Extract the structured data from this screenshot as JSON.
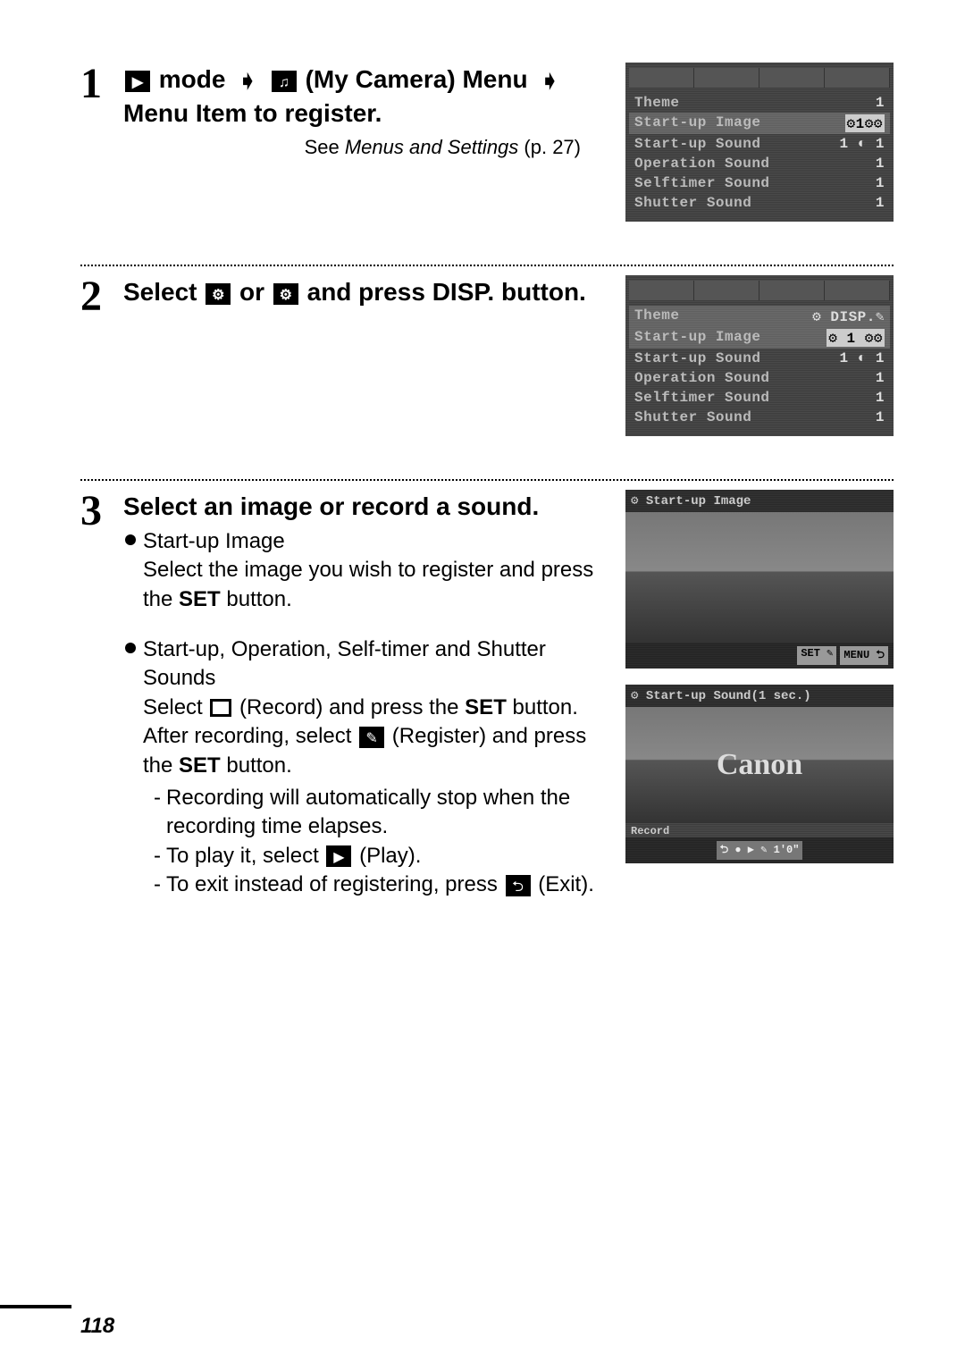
{
  "page_number": "118",
  "step1": {
    "num": "1",
    "title_part1": "mode",
    "title_part2": "(My Camera) Menu",
    "title_part3": "Menu Item to register.",
    "subtitle_prefix": "See ",
    "subtitle_ital": "Menus and Settings",
    "subtitle_suffix": " (p. 27)",
    "lcd": {
      "rows": [
        {
          "label": "Theme",
          "value": "1"
        },
        {
          "label": "Start-up Image",
          "value": "⚙1⚙⚙"
        },
        {
          "label": "Start-up Sound",
          "value": "1 ◐ 1"
        },
        {
          "label": "Operation Sound",
          "value": "1"
        },
        {
          "label": "Selftimer Sound",
          "value": "1"
        },
        {
          "label": "Shutter Sound",
          "value": "1"
        }
      ]
    }
  },
  "step2": {
    "num": "2",
    "title_a": "Select ",
    "title_b": " or ",
    "title_c": " and press ",
    "title_d": "DISP.",
    "title_e": " button.",
    "lcd": {
      "rows": [
        {
          "label": "Theme",
          "value": "⚙  DISP.✎"
        },
        {
          "label": "Start-up Image",
          "value": "⚙ 1 ⚙⚙"
        },
        {
          "label": "Start-up Sound",
          "value": "1 ◐ 1"
        },
        {
          "label": "Operation Sound",
          "value": "1"
        },
        {
          "label": "Selftimer Sound",
          "value": "1"
        },
        {
          "label": "Shutter Sound",
          "value": "1"
        }
      ]
    }
  },
  "step3": {
    "num": "3",
    "title": "Select an image or record a sound.",
    "bullet1_head": "Start-up Image",
    "bullet1_body_a": "Select the image you wish to register and press the ",
    "bullet1_body_set": "SET",
    "bullet1_body_b": " button.",
    "bullet2_head": "Start-up, Operation, Self-timer and Shutter Sounds",
    "bullet2_body_a": "Select ",
    "bullet2_body_b": " (Record) and press the ",
    "bullet2_body_set": "SET",
    "bullet2_body_c": " button. After recording, select ",
    "bullet2_body_d": " (Register) and press the ",
    "bullet2_body_set2": "SET",
    "bullet2_body_e": " button.",
    "sub1": "Recording will automatically stop when the recording time elapses.",
    "sub2_a": "To play it, select ",
    "sub2_b": " (Play).",
    "sub3_a": "To exit instead of registering, press ",
    "sub3_b": " (Exit).",
    "lcd_img": {
      "header": "⚙ Start-up Image",
      "footer_set": "SET ✎",
      "footer_menu": "MENU ⮌"
    },
    "lcd_sound": {
      "header": "⚙ Start-up Sound(1 sec.)",
      "brand": "Canon",
      "rec_label": "Record",
      "footer": "⮌ ● ▶ ✎   1'0\""
    }
  }
}
